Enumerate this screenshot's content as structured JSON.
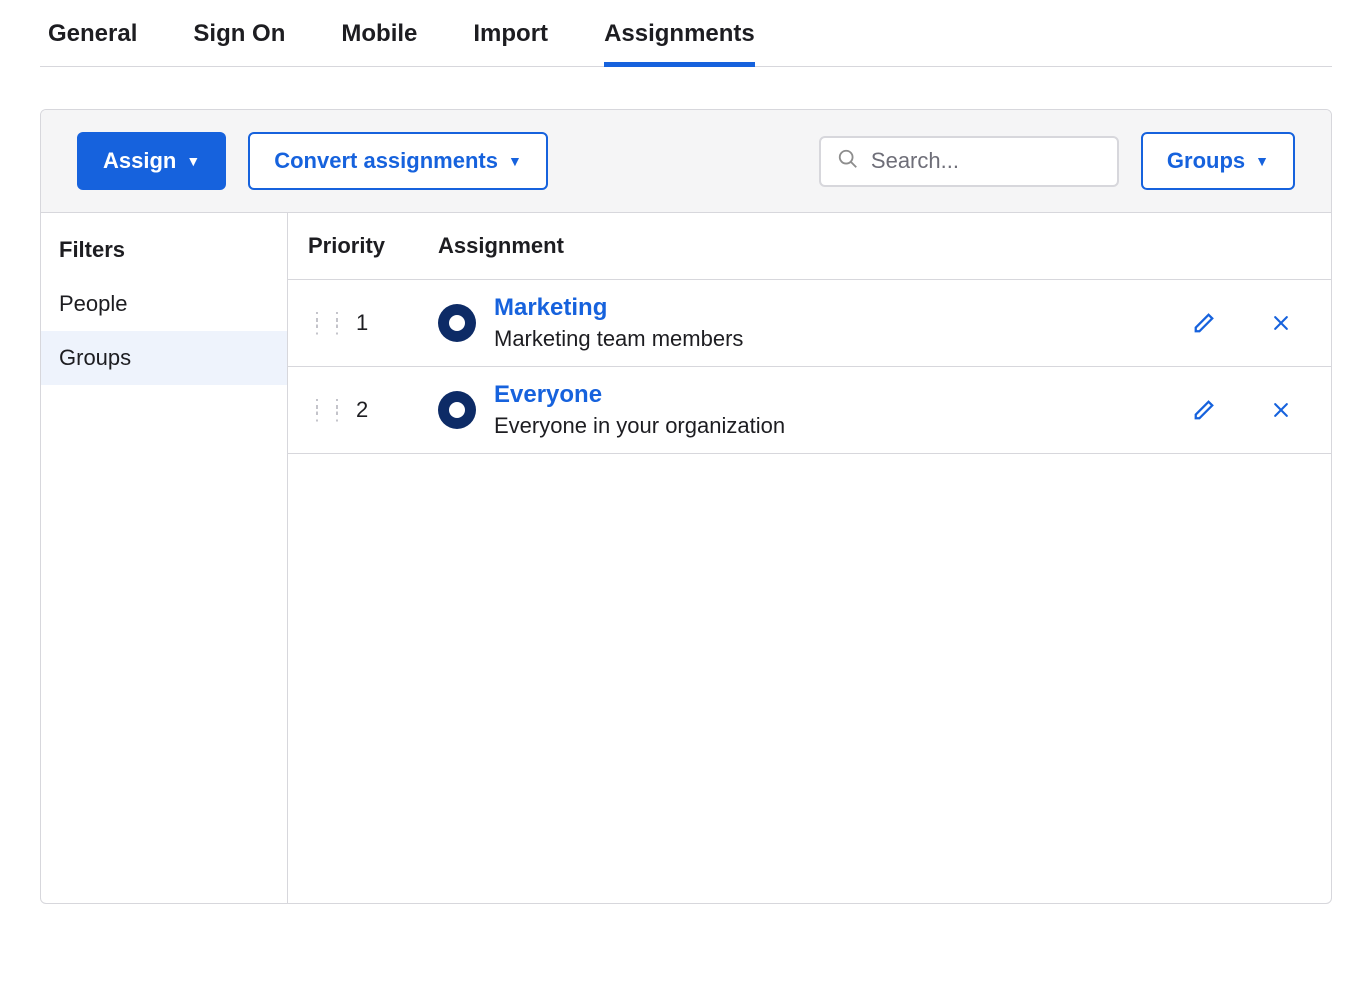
{
  "tabs": [
    {
      "label": "General"
    },
    {
      "label": "Sign On"
    },
    {
      "label": "Mobile"
    },
    {
      "label": "Import"
    },
    {
      "label": "Assignments",
      "active": true
    }
  ],
  "toolbar": {
    "assign_label": "Assign",
    "convert_label": "Convert assignments",
    "search_placeholder": "Search...",
    "groups_label": "Groups"
  },
  "sidebar": {
    "title": "Filters",
    "items": [
      {
        "label": "People"
      },
      {
        "label": "Groups",
        "active": true
      }
    ]
  },
  "columns": {
    "priority": "Priority",
    "assignment": "Assignment"
  },
  "rows": [
    {
      "priority": "1",
      "name": "Marketing",
      "desc": "Marketing team members"
    },
    {
      "priority": "2",
      "name": "Everyone",
      "desc": "Everyone in your organization"
    }
  ]
}
